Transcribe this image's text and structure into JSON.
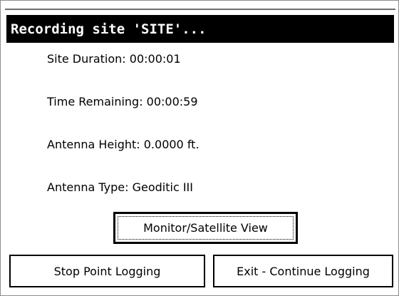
{
  "dialog": {
    "title": "Recording site 'SITE'..."
  },
  "info": {
    "site_duration": "Site Duration: 00:00:01",
    "time_remaining": "Time Remaining: 00:00:59",
    "antenna_height": "Antenna Height: 0.0000 ft.",
    "antenna_type": "Antenna Type: Geoditic III"
  },
  "buttons": {
    "monitor_label": "Monitor/Satellite View",
    "stop_label": "Stop Point Logging",
    "exit_label": "Exit - Continue Logging"
  },
  "colors": {
    "title_background": "#000000",
    "title_text": "#ffffff",
    "dialog_background": "#ffffff"
  }
}
